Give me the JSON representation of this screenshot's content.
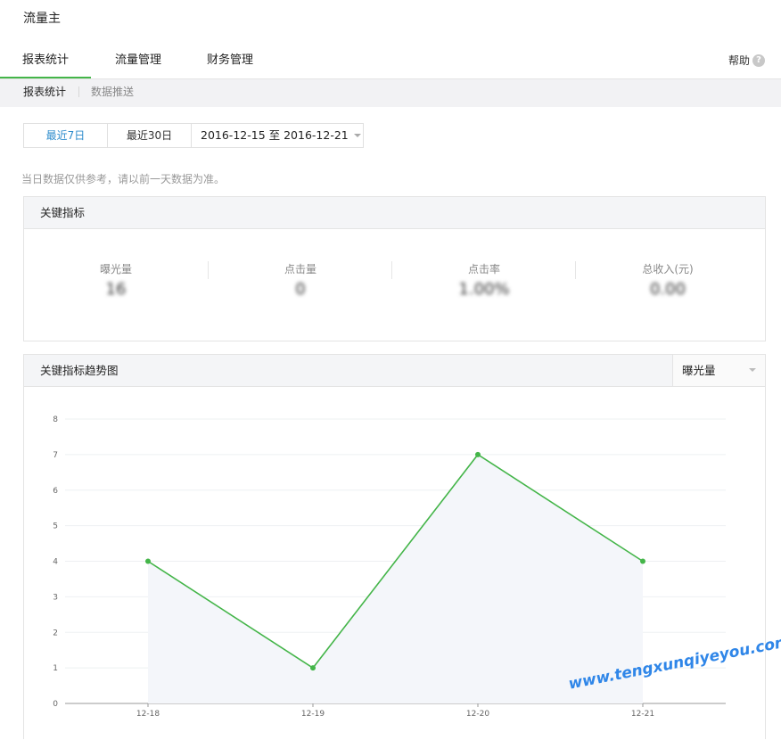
{
  "app": {
    "title": "流量主"
  },
  "main_tabs": [
    {
      "label": "报表统计",
      "active": true
    },
    {
      "label": "流量管理",
      "active": false
    },
    {
      "label": "财务管理",
      "active": false
    }
  ],
  "help": {
    "label": "帮助",
    "icon": "question-icon"
  },
  "sub_tabs": [
    {
      "label": "报表统计",
      "active": true
    },
    {
      "label": "数据推送",
      "active": false
    }
  ],
  "date_range": {
    "options": [
      "最近7日",
      "最近30日"
    ],
    "selected": "最近7日",
    "custom_label": "2016-12-15 至 2016-12-21"
  },
  "notice": "当日数据仅供参考，请以前一天数据为准。",
  "key_metrics": {
    "title": "关键指标",
    "items": [
      {
        "label": "曝光量",
        "value": "16"
      },
      {
        "label": "点击量",
        "value": "0"
      },
      {
        "label": "点击率",
        "value": "1.00%"
      },
      {
        "label": "总收入(元)",
        "value": "0.00"
      }
    ]
  },
  "trend": {
    "title": "关键指标趋势图",
    "metric_select": "曝光量"
  },
  "chart_data": {
    "type": "line",
    "categories": [
      "12-18",
      "12-19",
      "12-20",
      "12-21"
    ],
    "series": [
      {
        "values": [
          4,
          1,
          7,
          4
        ]
      }
    ],
    "yticks": [
      0,
      1,
      2,
      3,
      4,
      5,
      6,
      7,
      8
    ],
    "ylim": [
      0,
      8
    ],
    "grid": true,
    "line_color": "#44b549",
    "area_fill": "#f4f6fa"
  },
  "colors": {
    "accent": "#44b549",
    "link": "#2e8ccc"
  },
  "watermark": "www.tengxunqiyeyou.com"
}
